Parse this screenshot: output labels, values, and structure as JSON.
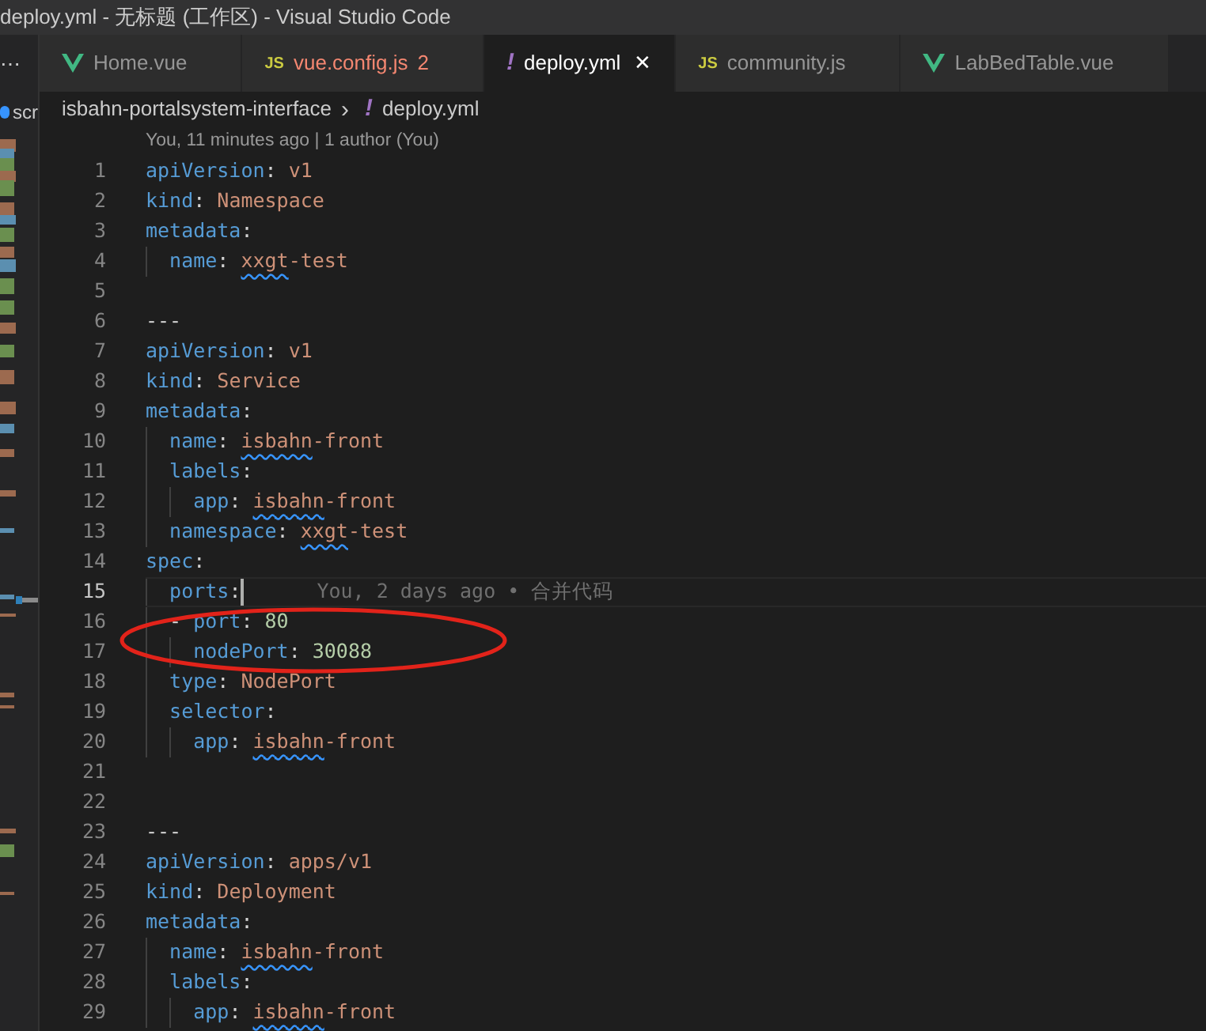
{
  "window": {
    "title": "deploy.yml - 无标题 (工作区) - Visual Studio Code"
  },
  "sidebar": {
    "more": "⋯",
    "item": "scr"
  },
  "tabs": [
    {
      "kind": "vue",
      "label": "Home.vue",
      "selected": false,
      "errors": false
    },
    {
      "kind": "js",
      "icon_text": "JS",
      "label": "vue.config.js",
      "badge": "2",
      "selected": false,
      "errors": true
    },
    {
      "kind": "yaml",
      "icon_text": "!",
      "label": "deploy.yml",
      "close": "✕",
      "selected": true,
      "errors": false
    },
    {
      "kind": "js",
      "icon_text": "JS",
      "label": "community.js",
      "selected": false,
      "errors": false
    },
    {
      "kind": "vue",
      "label": "LabBedTable.vue",
      "selected": false,
      "errors": false
    }
  ],
  "breadcrumb": {
    "folder": "isbahn-portalsystem-interface",
    "separator": "›",
    "file_icon": "!",
    "file": "deploy.yml"
  },
  "codelens": "You, 11 minutes ago | 1 author (You)",
  "editor": {
    "lines": [
      {
        "number": "1",
        "current": false,
        "tokens": [
          {
            "kind": "key",
            "text": "apiVersion"
          },
          {
            "kind": "punct",
            "text": ": "
          },
          {
            "kind": "string",
            "text": "v1"
          }
        ]
      },
      {
        "number": "2",
        "current": false,
        "tokens": [
          {
            "kind": "key",
            "text": "kind"
          },
          {
            "kind": "punct",
            "text": ": "
          },
          {
            "kind": "string",
            "text": "Namespace"
          }
        ]
      },
      {
        "number": "3",
        "current": false,
        "tokens": [
          {
            "kind": "key",
            "text": "metadata"
          },
          {
            "kind": "punct",
            "text": ":"
          }
        ]
      },
      {
        "number": "4",
        "current": false,
        "tokens": [
          {
            "kind": "key",
            "text": "  name"
          },
          {
            "kind": "punct",
            "text": ": "
          },
          {
            "kind": "flagged",
            "text": "xxgt"
          },
          {
            "kind": "string",
            "text": "-test"
          }
        ]
      },
      {
        "number": "5",
        "current": false
      },
      {
        "number": "6",
        "current": false,
        "tokens": [
          {
            "kind": "punct",
            "text": "---"
          }
        ]
      },
      {
        "number": "7",
        "current": false,
        "tokens": [
          {
            "kind": "key",
            "text": "apiVersion"
          },
          {
            "kind": "punct",
            "text": ": "
          },
          {
            "kind": "string",
            "text": "v1"
          }
        ]
      },
      {
        "number": "8",
        "current": false,
        "tokens": [
          {
            "kind": "key",
            "text": "kind"
          },
          {
            "kind": "punct",
            "text": ": "
          },
          {
            "kind": "string",
            "text": "Service"
          }
        ]
      },
      {
        "number": "9",
        "current": false,
        "tokens": [
          {
            "kind": "key",
            "text": "metadata"
          },
          {
            "kind": "punct",
            "text": ":"
          }
        ]
      },
      {
        "number": "10",
        "current": false,
        "tokens": [
          {
            "kind": "key",
            "text": "  name"
          },
          {
            "kind": "punct",
            "text": ": "
          },
          {
            "kind": "flagged",
            "text": "isbahn"
          },
          {
            "kind": "string",
            "text": "-front"
          }
        ]
      },
      {
        "number": "11",
        "current": false,
        "tokens": [
          {
            "kind": "key",
            "text": "  labels"
          },
          {
            "kind": "punct",
            "text": ":"
          }
        ]
      },
      {
        "number": "12",
        "current": false,
        "tokens": [
          {
            "kind": "key",
            "text": "    app"
          },
          {
            "kind": "punct",
            "text": ": "
          },
          {
            "kind": "flagged",
            "text": "isbahn"
          },
          {
            "kind": "string",
            "text": "-front"
          }
        ]
      },
      {
        "number": "13",
        "current": false,
        "tokens": [
          {
            "kind": "key",
            "text": "  namespace"
          },
          {
            "kind": "punct",
            "text": ": "
          },
          {
            "kind": "flagged",
            "text": "xxgt"
          },
          {
            "kind": "string",
            "text": "-test"
          }
        ]
      },
      {
        "number": "14",
        "current": false,
        "tokens": [
          {
            "kind": "key",
            "text": "spec"
          },
          {
            "kind": "punct",
            "text": ":"
          }
        ]
      },
      {
        "number": "15",
        "current": true,
        "tokens": [
          {
            "kind": "key",
            "text": "  ports"
          },
          {
            "kind": "punct",
            "text": ":"
          }
        ],
        "blame": "You, 2 days ago • 合并代码"
      },
      {
        "number": "16",
        "current": false,
        "tokens": [
          {
            "kind": "punct",
            "text": "  - "
          },
          {
            "kind": "key",
            "text": "port"
          },
          {
            "kind": "punct",
            "text": ": "
          },
          {
            "kind": "number",
            "text": "80"
          }
        ]
      },
      {
        "number": "17",
        "current": false,
        "tokens": [
          {
            "kind": "key",
            "text": "    nodePort"
          },
          {
            "kind": "punct",
            "text": ": "
          },
          {
            "kind": "number",
            "text": "30088"
          }
        ]
      },
      {
        "number": "18",
        "current": false,
        "tokens": [
          {
            "kind": "key",
            "text": "  type"
          },
          {
            "kind": "punct",
            "text": ": "
          },
          {
            "kind": "string",
            "text": "NodePort"
          }
        ]
      },
      {
        "number": "19",
        "current": false,
        "tokens": [
          {
            "kind": "key",
            "text": "  selector"
          },
          {
            "kind": "punct",
            "text": ":"
          }
        ]
      },
      {
        "number": "20",
        "current": false,
        "tokens": [
          {
            "kind": "key",
            "text": "    app"
          },
          {
            "kind": "punct",
            "text": ": "
          },
          {
            "kind": "flagged",
            "text": "isbahn"
          },
          {
            "kind": "string",
            "text": "-front"
          }
        ]
      },
      {
        "number": "21",
        "current": false
      },
      {
        "number": "22",
        "current": false
      },
      {
        "number": "23",
        "current": false,
        "tokens": [
          {
            "kind": "punct",
            "text": "---"
          }
        ]
      },
      {
        "number": "24",
        "current": false,
        "tokens": [
          {
            "kind": "key",
            "text": "apiVersion"
          },
          {
            "kind": "punct",
            "text": ": "
          },
          {
            "kind": "string",
            "text": "apps/v1"
          }
        ]
      },
      {
        "number": "25",
        "current": false,
        "tokens": [
          {
            "kind": "key",
            "text": "kind"
          },
          {
            "kind": "punct",
            "text": ": "
          },
          {
            "kind": "string",
            "text": "Deployment"
          }
        ]
      },
      {
        "number": "26",
        "current": false,
        "tokens": [
          {
            "kind": "key",
            "text": "metadata"
          },
          {
            "kind": "punct",
            "text": ":"
          }
        ]
      },
      {
        "number": "27",
        "current": false,
        "tokens": [
          {
            "kind": "key",
            "text": "  name"
          },
          {
            "kind": "punct",
            "text": ": "
          },
          {
            "kind": "flagged",
            "text": "isbahn"
          },
          {
            "kind": "string",
            "text": "-front"
          }
        ]
      },
      {
        "number": "28",
        "current": false,
        "tokens": [
          {
            "kind": "key",
            "text": "  labels"
          },
          {
            "kind": "punct",
            "text": ":"
          }
        ]
      },
      {
        "number": "29",
        "current": false,
        "tokens": [
          {
            "kind": "key",
            "text": "    app"
          },
          {
            "kind": "punct",
            "text": ": "
          },
          {
            "kind": "flagged",
            "text": "isbahn"
          },
          {
            "kind": "string",
            "text": "-front"
          }
        ]
      }
    ]
  }
}
